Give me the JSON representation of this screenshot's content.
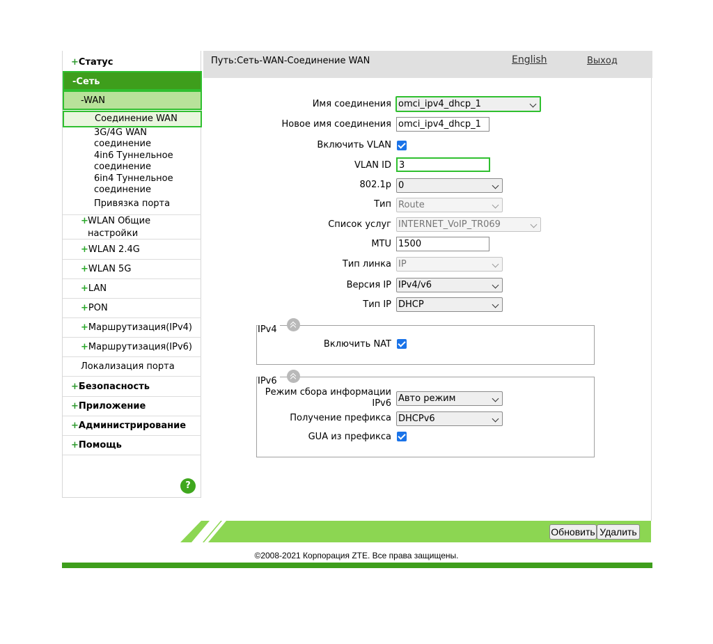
{
  "sidebar": {
    "status": "Статус",
    "network": "Сеть",
    "wan": "WAN",
    "wan_items": [
      "Соединение WAN",
      "3G/4G WAN\nсоединение",
      "4in6 Туннельное\nсоединение",
      "6in4 Туннельное\nсоединение",
      "Привязка порта"
    ],
    "wlan_general": "WLAN Общие\nнастройки",
    "wlan24": "WLAN 2.4G",
    "wlan5": "WLAN 5G",
    "lan": "LAN",
    "pon": "PON",
    "routing4": "Маршрутизация(IPv4)",
    "routing6": "Маршрутизация(IPv6)",
    "port_local": "Локализация порта",
    "security": "Безопасность",
    "application": "Приложение",
    "admin": "Администрирование",
    "help": "Помощь",
    "help_icon": "?"
  },
  "header": {
    "path": "Путь:Сеть-WAN-Соединение WAN",
    "lang": "English",
    "logout": "Выход"
  },
  "form": {
    "conn_name_label": "Имя соединения",
    "conn_name_value": "omci_ipv4_dhcp_1",
    "new_name_label": "Новое имя соединения",
    "new_name_value": "omci_ipv4_dhcp_1",
    "vlan_enable_label": "Включить VLAN",
    "vlan_id_label": "VLAN ID",
    "vlan_id_value": "3",
    "dot1p_label": "802.1p",
    "dot1p_value": "0",
    "type_label": "Тип",
    "type_value": "Route",
    "service_label": "Список услуг",
    "service_value": "INTERNET_VoIP_TR069",
    "mtu_label": "MTU",
    "mtu_value": "1500",
    "link_type_label": "Тип линка",
    "link_type_value": "IP",
    "ip_version_label": "Версия IP",
    "ip_version_value": "IPv4/v6",
    "ip_type_label": "Тип IP",
    "ip_type_value": "DHCP"
  },
  "ipv4": {
    "legend": "IPv4",
    "nat_label": "Включить NAT"
  },
  "ipv6": {
    "legend": "IPv6",
    "mode_label": "Режим сбора информации\nIPv6",
    "mode_value": "Авто режим",
    "prefix_label": "Получение префикса",
    "prefix_value": "DHCPv6",
    "gua_label": "GUA из префикса"
  },
  "footer": {
    "refresh": "Обновить",
    "delete": "Удалить",
    "copyright": "©2008-2021 Корпорация ZTE. Все права защищены."
  },
  "colors": {
    "brand_green": "#3e9e1c",
    "highlight": "#2fbf2f",
    "light_green": "#b8e29a",
    "checkbox": "#1a73e8"
  }
}
